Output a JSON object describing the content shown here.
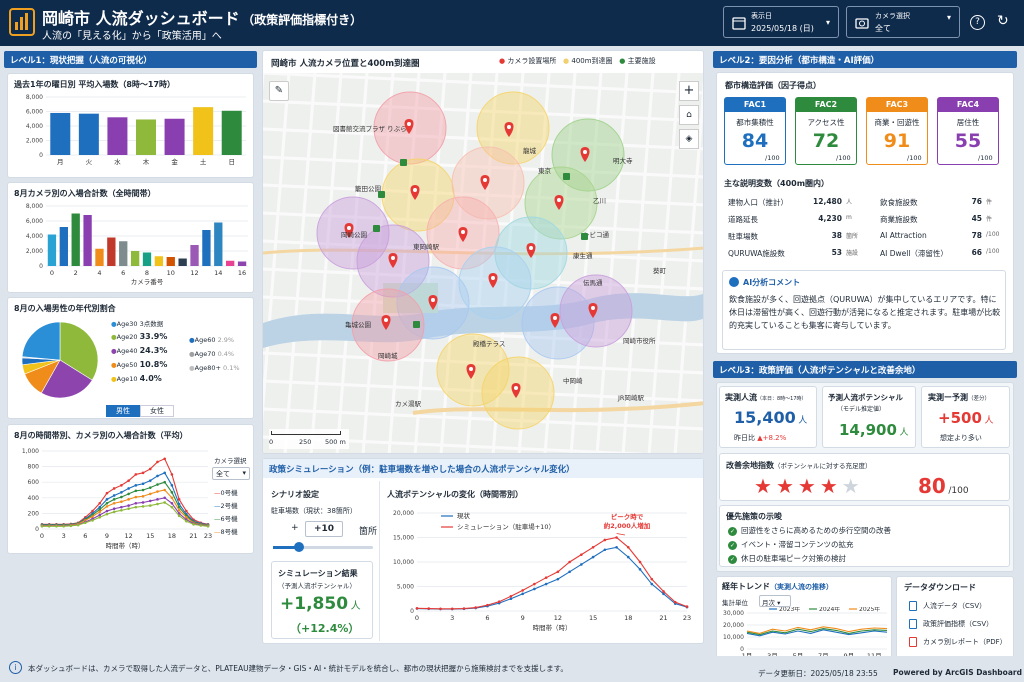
{
  "header": {
    "title": "岡崎市 人流ダッシュボード",
    "title_suffix": "（政策評価指標付き）",
    "subtitle": "人流の「見える化」から「政策活用」へ",
    "date_label": "表示日",
    "date_value": "2025/05/18 (日)",
    "camera_label": "カメラ選択",
    "camera_value": "全て",
    "help": "?"
  },
  "level1": {
    "title": "レベル1：現状把握（人流の可視化）",
    "weekday": {
      "title": "過去1年の曜日別 平均入場数（8時〜17時）",
      "yticks": [
        "8,000",
        "6,000",
        "4,000",
        "2,000",
        "0"
      ]
    },
    "camera_total": {
      "title": "8月カメラ別の入場合計数（全時間帯）",
      "yticks": [
        "8,000",
        "6,000",
        "4,000",
        "2,000",
        "0"
      ],
      "xlabel": "カメラ番号"
    },
    "age": {
      "title": "8月の入場男性の年代別割合",
      "legend_left": [
        {
          "label": "Age30",
          "value": "3点数据"
        },
        {
          "label": "Age20",
          "value": "33.9%"
        },
        {
          "label": "Age40",
          "value": "24.3%"
        },
        {
          "label": "Age50",
          "value": "10.8%"
        },
        {
          "label": "Age10",
          "value": "4.0%"
        }
      ],
      "legend_right": [
        {
          "label": "Age60",
          "value": "2.9%"
        },
        {
          "label": "Age70",
          "value": "0.4%"
        },
        {
          "label": "Age80+",
          "value": "0.1%"
        }
      ],
      "tab_male": "男性",
      "tab_female": "女性"
    },
    "hourly": {
      "title": "8月の時間帯別、カメラ別の入場合計数（平均）",
      "yticks": [
        "1,000",
        "800",
        "600",
        "400",
        "200",
        "0"
      ],
      "xlabel": "時間帯（時）",
      "camera_select_label": "カメラ選択",
      "camera_select_value": "全て",
      "legend": [
        "0号機",
        "2号機",
        "6号機",
        "8号機"
      ]
    }
  },
  "map": {
    "title": "岡崎市 人流カメラ位置と400m到達圏",
    "legend": [
      "カメラ設置場所",
      "400m到達圏",
      "主要施設"
    ],
    "labels": [
      "図書館交流プラザ りぶら",
      "東岡崎駅",
      "亀城公園",
      "岡崎城",
      "岡崎公園",
      "東京",
      "龍城",
      "明大寺",
      "乙川",
      "籠田公園",
      "康生通",
      "殿橋テラス",
      "カメ湯駅",
      "岡崎市役所",
      "JR岡崎駅",
      "中岡崎",
      "シビコ通",
      "伝馬通",
      "葵町"
    ],
    "scale": [
      "0",
      "250",
      "500 m"
    ]
  },
  "sim": {
    "title": "政策シミュレーション（例：駐車場数を増やした場合の人流ポテンシャル変化）",
    "scenario_title": "シナリオ設定",
    "parking_label": "駐車場数（現状：38箇所）",
    "step_value": "+10",
    "step_unit": "箇所",
    "result_title": "シミュレーション結果",
    "result_sub": "（予測人流ポテンシャル）",
    "result_value": "+1,850",
    "result_unit": "人",
    "result_pct": "（+12.4%）",
    "chart_title": "人流ポテンシャルの変化（時間帯別）",
    "legend_now": "現状",
    "legend_sim": "シミュレーション（駐車場+10）",
    "annotation": "ピーク時で\n約2,000人増加",
    "xlabel": "時間帯（時）",
    "yticks": [
      "20,000",
      "15,000",
      "10,000",
      "5,000",
      "0"
    ]
  },
  "level2": {
    "title": "レベル2：要因分析（都市構造・AI評価）",
    "eval_title": "都市構造評価（因子得点）",
    "fac": [
      {
        "id": "FAC1",
        "name": "都市集積性",
        "score": "84",
        "max": "/100",
        "color": "#1f6fbf"
      },
      {
        "id": "FAC2",
        "name": "アクセス性",
        "score": "72",
        "max": "/100",
        "color": "#2e8b3e"
      },
      {
        "id": "FAC3",
        "name": "商業・回遊性",
        "score": "91",
        "max": "/100",
        "color": "#f08c1a"
      },
      {
        "id": "FAC4",
        "name": "居住性",
        "score": "55",
        "max": "/100",
        "color": "#8a3fb0"
      }
    ],
    "vars_title": "主な説明変数（400m圏内）",
    "vars_left": [
      {
        "k": "建物人口（推計）",
        "v": "12,480",
        "u": "人"
      },
      {
        "k": "道路延長",
        "v": "4,230",
        "u": "m"
      },
      {
        "k": "駐車場数",
        "v": "38",
        "u": "箇所"
      },
      {
        "k": "QURUWA施設数",
        "v": "53",
        "u": "施設"
      }
    ],
    "vars_right": [
      {
        "k": "飲食施設数",
        "v": "76",
        "u": "件"
      },
      {
        "k": "商業施設数",
        "v": "45",
        "u": "件"
      },
      {
        "k": "AI Attraction",
        "v": "78",
        "u": "/100"
      },
      {
        "k": "AI Dwell（滞留性）",
        "v": "66",
        "u": "/100"
      }
    ],
    "ai_title": "AI分析コメント",
    "ai_text": "飲食施設が多く、回遊拠点（QURUWA）が集中しているエリアです。特に休日は滞留性が高く、回遊行動が活発になると推定されます。駐車場が比較的充実していることも集客に寄与しています。"
  },
  "level3": {
    "title": "レベル3：政策評価（人流ポテンシャルと改善余地）",
    "actual_title": "実測人流",
    "actual_note": "（本日：8時〜17時）",
    "actual_value": "15,400",
    "actual_unit": "人",
    "actual_diff_label": "昨日比",
    "actual_diff": "+8.2%",
    "pred_title": "予測人流ポテンシャル",
    "pred_note": "（モデル推定値）",
    "pred_value": "14,900",
    "pred_unit": "人",
    "gap_title": "実測ー予測",
    "gap_note": "（差分）",
    "gap_value": "+500",
    "gap_unit": "人",
    "gap_caption": "想定より多い",
    "improve_title": "改善余地指数",
    "improve_note": "（ポテンシャルに対する充足度）",
    "improve_value": "80",
    "improve_max": "/100",
    "stars": 4,
    "policy_title": "優先施策の示唆",
    "policies": [
      "回遊性をさらに高めるための歩行空間の改善",
      "イベント・滞留コンテンツの拡充",
      "休日の駐車場ピーク対策の検討"
    ]
  },
  "trend": {
    "title": "経年トレンド",
    "title_sub": "（実測人流の推移）",
    "unit_label": "集計単位",
    "unit_value": "月次",
    "legend": [
      "2023年",
      "2024年",
      "2025年"
    ],
    "yticks": [
      "30,000",
      "20,000",
      "10,000",
      "0"
    ],
    "xticks": [
      "1月",
      "3月",
      "5月",
      "7月",
      "9月",
      "11月"
    ]
  },
  "download": {
    "title": "データダウンロード",
    "items": [
      "人流データ（CSV）",
      "政策評価指標（CSV）",
      "カメラ別レポート（PDF）"
    ]
  },
  "footer": {
    "note": "本ダッシュボードは、カメラで取得した人流データと、PLATEAU建物データ・GIS・AI・統計モデルを統合し、都市の現状把握から施策検討までを支援します。",
    "updated": "データ更新日：2025/05/18 23:55",
    "powered": "Powered by ArcGIS Dashboard"
  },
  "chart_data": [
    {
      "type": "bar",
      "title": "過去1年の曜日別 平均入場数（8時〜17時）",
      "categories": [
        "月",
        "火",
        "水",
        "木",
        "金",
        "土",
        "日"
      ],
      "values": [
        5800,
        5700,
        5200,
        4900,
        5000,
        6600,
        6100
      ],
      "colors": [
        "#1f6fbf",
        "#1f6fbf",
        "#8a3fb0",
        "#8fb93a",
        "#8a3fb0",
        "#f0c21a",
        "#2e8b3e"
      ],
      "ylim": [
        0,
        8000
      ]
    },
    {
      "type": "bar",
      "title": "8月カメラ別の入場合計数（全時間帯）",
      "xlabel": "カメラ番号",
      "categories": [
        "0",
        "1",
        "2",
        "3",
        "4",
        "5",
        "6",
        "7",
        "8",
        "9",
        "10",
        "11",
        "12",
        "13",
        "14",
        "15",
        "16"
      ],
      "values": [
        4200,
        5200,
        7000,
        6800,
        2300,
        3800,
        3300,
        2000,
        1800,
        1300,
        1200,
        1000,
        2800,
        4800,
        5800,
        700,
        600
      ],
      "colors": [
        "#29a3d4",
        "#1f6fbf",
        "#2e8b3e",
        "#8a3fb0",
        "#f08c1a",
        "#c0392b",
        "#7f8c8d",
        "#8fb93a",
        "#16a085",
        "#f0c21a",
        "#d35400",
        "#2c3e50",
        "#9b59b6",
        "#1f6fbf",
        "#2e86c1",
        "#e84393",
        "#8e44ad"
      ],
      "ylim": [
        0,
        8000
      ]
    },
    {
      "type": "pie",
      "title": "8月の入場男性の年代別割合",
      "labels": [
        "Age20",
        "Age40",
        "Age50",
        "Age10",
        "Age60",
        "Age70",
        "Age80+",
        "Age30"
      ],
      "values": [
        33.9,
        24.3,
        10.8,
        4.0,
        2.9,
        0.4,
        0.1,
        23.6
      ],
      "colors": [
        "#8fb93a",
        "#8e44ad",
        "#f08c1a",
        "#f0c21a",
        "#1f6fbf",
        "#a0a0a0",
        "#c0c0c0",
        "#2a8fd6"
      ]
    },
    {
      "type": "line",
      "title": "8月の時間帯別、カメラ別の入場合計数（平均）",
      "xlabel": "時間帯（時）",
      "x": [
        0,
        1,
        2,
        3,
        4,
        5,
        6,
        7,
        8,
        9,
        10,
        11,
        12,
        13,
        14,
        15,
        16,
        17,
        18,
        19,
        20,
        21,
        22,
        23
      ],
      "ylim": [
        0,
        1000
      ],
      "series": [
        {
          "name": "0号機",
          "color": "#e53935",
          "values": [
            60,
            60,
            60,
            60,
            65,
            80,
            150,
            230,
            330,
            460,
            520,
            560,
            620,
            700,
            720,
            770,
            860,
            900,
            700,
            380,
            230,
            120,
            80,
            60
          ]
        },
        {
          "name": "2号機",
          "color": "#1f6fbf",
          "values": [
            55,
            55,
            55,
            55,
            60,
            75,
            130,
            200,
            280,
            380,
            430,
            470,
            520,
            560,
            580,
            620,
            680,
            720,
            560,
            320,
            190,
            100,
            70,
            55
          ]
        },
        {
          "name": "6号機",
          "color": "#2e8b3e",
          "values": [
            50,
            50,
            50,
            50,
            55,
            70,
            120,
            180,
            250,
            330,
            380,
            410,
            450,
            490,
            500,
            530,
            570,
            600,
            470,
            280,
            170,
            90,
            60,
            50
          ]
        },
        {
          "name": "8号機",
          "color": "#f08c1a",
          "values": [
            45,
            45,
            45,
            45,
            50,
            65,
            110,
            160,
            220,
            290,
            330,
            350,
            380,
            410,
            420,
            450,
            480,
            500,
            400,
            240,
            150,
            80,
            55,
            45
          ]
        },
        {
          "name": "",
          "color": "#8a3fb0",
          "values": [
            40,
            40,
            40,
            40,
            45,
            55,
            90,
            130,
            180,
            230,
            260,
            280,
            300,
            330,
            340,
            360,
            380,
            400,
            330,
            200,
            120,
            70,
            50,
            40
          ]
        },
        {
          "name": "",
          "color": "#8fb93a",
          "values": [
            35,
            35,
            35,
            35,
            40,
            50,
            80,
            110,
            150,
            190,
            220,
            240,
            260,
            280,
            290,
            300,
            320,
            340,
            280,
            170,
            100,
            60,
            45,
            35
          ]
        }
      ]
    },
    {
      "type": "line",
      "title": "人流ポテンシャルの変化（時間帯別）",
      "xlabel": "時間帯（時）",
      "x": [
        0,
        1,
        2,
        3,
        4,
        5,
        6,
        7,
        8,
        9,
        10,
        11,
        12,
        13,
        14,
        15,
        16,
        17,
        18,
        19,
        20,
        21,
        22,
        23
      ],
      "ylim": [
        0,
        20000
      ],
      "series": [
        {
          "name": "現状",
          "color": "#1f6fbf",
          "values": [
            500,
            450,
            400,
            400,
            450,
            600,
            1000,
            1600,
            2500,
            3500,
            4500,
            5500,
            6500,
            8000,
            9500,
            11000,
            12500,
            13000,
            11000,
            8500,
            5500,
            3500,
            1500,
            800
          ]
        },
        {
          "name": "シミュレーション（駐車場+10）",
          "color": "#e53935",
          "values": [
            550,
            500,
            450,
            450,
            500,
            700,
            1200,
            1900,
            3000,
            4200,
            5500,
            6800,
            8000,
            10000,
            11500,
            13000,
            14500,
            15000,
            13000,
            10000,
            6500,
            4000,
            1800,
            900
          ]
        }
      ]
    },
    {
      "type": "line",
      "title": "経年トレンド",
      "x": [
        "1月",
        "2月",
        "3月",
        "4月",
        "5月",
        "6月",
        "7月",
        "8月",
        "9月",
        "10月",
        "11月",
        "12月"
      ],
      "ylim": [
        0,
        30000
      ],
      "series": [
        {
          "name": "2023年",
          "color": "#1f6fbf",
          "values": [
            13000,
            11000,
            14000,
            12500,
            15000,
            13000,
            16000,
            14000,
            12000,
            13500,
            15000,
            14000
          ]
        },
        {
          "name": "2024年",
          "color": "#2e8b3e",
          "values": [
            14000,
            12000,
            15000,
            13500,
            16500,
            14500,
            17000,
            15500,
            13000,
            15000,
            16000,
            15500
          ]
        },
        {
          "name": "2025年",
          "color": "#f08c1a",
          "values": [
            15000,
            13000,
            16500,
            15000,
            18000,
            16000,
            18500,
            17000,
            14500,
            16500,
            17500,
            17000
          ]
        }
      ]
    }
  ]
}
